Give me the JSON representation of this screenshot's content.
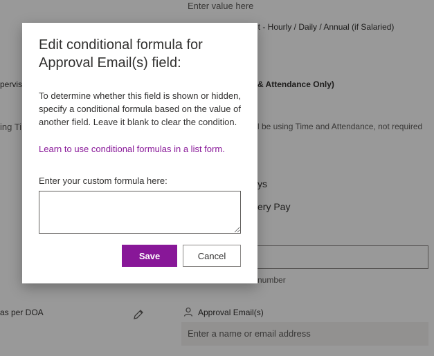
{
  "background_form": {
    "input_placeholder_top": "Enter value here",
    "field_label_top": "nt - Hourly / Daily / Annual (if Salaried)",
    "left_label_supervisor": "pervis",
    "field_label_time": "& Attendance Only)",
    "left_label_time": "ing Ti",
    "helper_time": "l be using Time and Attendance, not required",
    "field_value_days": "ys",
    "field_value_pay": "ery Pay",
    "helper_number": "number",
    "left_label_doa": "as per DOA",
    "approval_label": "Approval Email(s)",
    "approval_placeholder": "Enter a name or email address"
  },
  "dialog": {
    "title": "Edit conditional formula for Approval Email(s) field:",
    "description": "To determine whether this field is shown or hidden, specify a conditional formula based on the value of another field. Leave it blank to clear the condition.",
    "link_text": "Learn to use conditional formulas in a list form",
    "link_suffix": ".",
    "formula_label": "Enter your custom formula here:",
    "formula_value": "",
    "save_label": "Save",
    "cancel_label": "Cancel"
  },
  "colors": {
    "accent": "#881798",
    "overlay": "rgba(0,0,0,0.40)"
  }
}
